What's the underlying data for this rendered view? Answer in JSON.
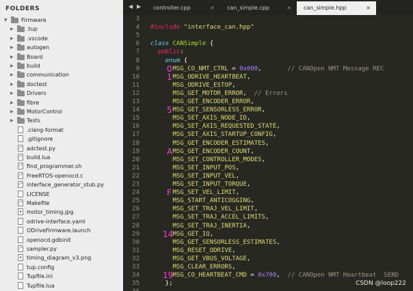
{
  "sidebar": {
    "title": "FOLDERS",
    "root": "Firmware",
    "folders": [
      ".tup",
      ".vscode",
      "autogen",
      "Board",
      "build",
      "communication",
      "doctest",
      "Drivers",
      "fibre",
      "MotorControl",
      "Tests"
    ],
    "files": [
      {
        "name": ".clang-format",
        "icon": "file-icon"
      },
      {
        "name": ".gitignore",
        "icon": "file-icon"
      },
      {
        "name": "adctest.py",
        "icon": "code-file-icon"
      },
      {
        "name": "build.lua",
        "icon": "code-file-icon"
      },
      {
        "name": "find_programmer.sh",
        "icon": "code-file-icon"
      },
      {
        "name": "FreeRTOS-openocd.c",
        "icon": "code-file-icon"
      },
      {
        "name": "interface_generator_stub.py",
        "icon": "code-file-icon"
      },
      {
        "name": "LICENSE",
        "icon": "file-icon"
      },
      {
        "name": "Makefile",
        "icon": "code-file-icon"
      },
      {
        "name": "motor_timing.jpg",
        "icon": "image-file-icon"
      },
      {
        "name": "odrive-interface.yaml",
        "icon": "file-icon"
      },
      {
        "name": "ODriveFirmware.launch",
        "icon": "file-icon"
      },
      {
        "name": "openocd.gdbinit",
        "icon": "file-icon"
      },
      {
        "name": "sampler.py",
        "icon": "code-file-icon"
      },
      {
        "name": "timing_diagram_v3.png",
        "icon": "image-file-icon"
      },
      {
        "name": "tup.config",
        "icon": "file-icon"
      },
      {
        "name": "Tupfile.ini",
        "icon": "file-icon"
      },
      {
        "name": "Tupfile.lua",
        "icon": "file-icon"
      }
    ]
  },
  "tabs": [
    {
      "label": "controller.cpp",
      "active": false,
      "close": "×"
    },
    {
      "label": "can_simple.cpp",
      "active": false,
      "close": "×"
    },
    {
      "label": "can_simple.hpp",
      "active": true,
      "close": "×"
    }
  ],
  "tab_nav": {
    "left": "◀",
    "right": "▶"
  },
  "editor": {
    "lines": [
      {
        "n": "3",
        "segs": []
      },
      {
        "n": "4",
        "segs": [
          [
            "kw-pre",
            "#include "
          ],
          [
            "str",
            "\"interface_can.hpp\""
          ]
        ]
      },
      {
        "n": "5",
        "segs": []
      },
      {
        "n": "6",
        "segs": [
          [
            "kw-class",
            "class"
          ],
          [
            "pun",
            " "
          ],
          [
            "cls",
            "CANSimple"
          ],
          [
            "pun",
            " {"
          ]
        ]
      },
      {
        "n": "7",
        "segs": [
          [
            "pun",
            "  "
          ],
          [
            "kw",
            "public"
          ],
          [
            "pun",
            ":"
          ]
        ]
      },
      {
        "n": "8",
        "segs": [
          [
            "pun",
            "    "
          ],
          [
            "kw-enum",
            "enum"
          ],
          [
            "pun",
            " {"
          ]
        ]
      },
      {
        "n": "9",
        "segs": [
          [
            "pun",
            "      "
          ],
          [
            "enumv",
            "MSG_CO_NMT_CTRL"
          ],
          [
            "pun",
            " = "
          ],
          [
            "num",
            "0x000"
          ],
          [
            "pun",
            ",       "
          ],
          [
            "cmt",
            "// CANOpen NMT Message REC"
          ]
        ]
      },
      {
        "n": "10",
        "segs": [
          [
            "pun",
            "      "
          ],
          [
            "enumv",
            "MSG_ODRIVE_HEARTBEAT"
          ],
          [
            "pun",
            ","
          ]
        ]
      },
      {
        "n": "11",
        "segs": [
          [
            "pun",
            "      "
          ],
          [
            "enumv",
            "MSG_ODRIVE_ESTOP"
          ],
          [
            "pun",
            ","
          ]
        ]
      },
      {
        "n": "12",
        "segs": [
          [
            "pun",
            "      "
          ],
          [
            "enumv",
            "MSG_GET_MOTOR_ERROR"
          ],
          [
            "pun",
            ",  "
          ],
          [
            "cmt",
            "// Errors"
          ]
        ]
      },
      {
        "n": "13",
        "segs": [
          [
            "pun",
            "      "
          ],
          [
            "enumv",
            "MSG_GET_ENCODER_ERROR"
          ],
          [
            "pun",
            ","
          ]
        ]
      },
      {
        "n": "14",
        "segs": [
          [
            "pun",
            "      "
          ],
          [
            "enumv",
            "MSG_GET_SENSORLESS_ERROR"
          ],
          [
            "pun",
            ","
          ]
        ]
      },
      {
        "n": "15",
        "segs": [
          [
            "pun",
            "      "
          ],
          [
            "enumv",
            "MSG_SET_AXIS_NODE_ID"
          ],
          [
            "pun",
            ","
          ]
        ]
      },
      {
        "n": "16",
        "segs": [
          [
            "pun",
            "      "
          ],
          [
            "enumv",
            "MSG_SET_AXIS_REQUESTED_STATE"
          ],
          [
            "pun",
            ","
          ]
        ]
      },
      {
        "n": "17",
        "segs": [
          [
            "pun",
            "      "
          ],
          [
            "enumv",
            "MSG_SET_AXIS_STARTUP_CONFIG"
          ],
          [
            "pun",
            ","
          ]
        ]
      },
      {
        "n": "18",
        "segs": [
          [
            "pun",
            "      "
          ],
          [
            "enumv",
            "MSG_GET_ENCODER_ESTIMATES"
          ],
          [
            "pun",
            ","
          ]
        ]
      },
      {
        "n": "19",
        "segs": [
          [
            "pun",
            "      "
          ],
          [
            "enumv",
            "MSG_GET_ENCODER_COUNT"
          ],
          [
            "pun",
            ","
          ]
        ]
      },
      {
        "n": "20",
        "segs": [
          [
            "pun",
            "      "
          ],
          [
            "enumv",
            "MSG_SET_CONTROLLER_MODES"
          ],
          [
            "pun",
            ","
          ]
        ]
      },
      {
        "n": "21",
        "segs": [
          [
            "pun",
            "      "
          ],
          [
            "enumv",
            "MSG_SET_INPUT_POS"
          ],
          [
            "pun",
            ","
          ]
        ]
      },
      {
        "n": "22",
        "segs": [
          [
            "pun",
            "      "
          ],
          [
            "enumv",
            "MSG_SET_INPUT_VEL"
          ],
          [
            "pun",
            ","
          ]
        ]
      },
      {
        "n": "23",
        "segs": [
          [
            "pun",
            "      "
          ],
          [
            "enumv",
            "MSG_SET_INPUT_TORQUE"
          ],
          [
            "pun",
            ","
          ]
        ]
      },
      {
        "n": "24",
        "segs": [
          [
            "pun",
            "      "
          ],
          [
            "enumv",
            "MSG_SET_VEL_LIMIT"
          ],
          [
            "pun",
            ","
          ]
        ]
      },
      {
        "n": "25",
        "segs": [
          [
            "pun",
            "      "
          ],
          [
            "enumv",
            "MSG_START_ANTICOGGING"
          ],
          [
            "pun",
            ","
          ]
        ]
      },
      {
        "n": "26",
        "segs": [
          [
            "pun",
            "      "
          ],
          [
            "enumv",
            "MSG_SET_TRAJ_VEL_LIMIT"
          ],
          [
            "pun",
            ","
          ]
        ]
      },
      {
        "n": "27",
        "segs": [
          [
            "pun",
            "      "
          ],
          [
            "enumv",
            "MSG_SET_TRAJ_ACCEL_LIMITS"
          ],
          [
            "pun",
            ","
          ]
        ]
      },
      {
        "n": "28",
        "segs": [
          [
            "pun",
            "      "
          ],
          [
            "enumv",
            "MSG_SET_TRAJ_INERTIA"
          ],
          [
            "pun",
            ","
          ]
        ]
      },
      {
        "n": "29",
        "segs": [
          [
            "pun",
            "      "
          ],
          [
            "enumv",
            "MSG_GET_IQ"
          ],
          [
            "pun",
            ","
          ]
        ]
      },
      {
        "n": "30",
        "segs": [
          [
            "pun",
            "      "
          ],
          [
            "enumv",
            "MSG_GET_SENSORLESS_ESTIMATES"
          ],
          [
            "pun",
            ","
          ]
        ]
      },
      {
        "n": "31",
        "segs": [
          [
            "pun",
            "      "
          ],
          [
            "enumv",
            "MSG_RESET_ODRIVE"
          ],
          [
            "pun",
            ","
          ]
        ]
      },
      {
        "n": "32",
        "segs": [
          [
            "pun",
            "      "
          ],
          [
            "enumv",
            "MSG_GET_VBUS_VOLTAGE"
          ],
          [
            "pun",
            ","
          ]
        ]
      },
      {
        "n": "33",
        "segs": [
          [
            "pun",
            "      "
          ],
          [
            "enumv",
            "MSG_CLEAR_ERRORS"
          ],
          [
            "pun",
            ","
          ]
        ]
      },
      {
        "n": "34",
        "segs": [
          [
            "pun",
            "      "
          ],
          [
            "enumv",
            "MSG_CO_HEARTBEAT_CMD"
          ],
          [
            "pun",
            " = "
          ],
          [
            "num",
            "0x700"
          ],
          [
            "pun",
            ",  "
          ],
          [
            "cmt",
            "// CANOpen NMT Heartbeat  SEND"
          ]
        ]
      },
      {
        "n": "35",
        "segs": [
          [
            "pun",
            "    };"
          ]
        ]
      },
      {
        "n": "36",
        "segs": []
      }
    ],
    "annotations": [
      {
        "line": 6,
        "text": "0"
      },
      {
        "line": 7,
        "text": "1"
      },
      {
        "line": 11,
        "text": "5"
      },
      {
        "line": 16,
        "text": "A"
      },
      {
        "line": 21,
        "text": "F"
      },
      {
        "line": 26,
        "text": "14"
      },
      {
        "line": 31,
        "text": "19"
      }
    ],
    "annotation_color": "#ff3ddc"
  },
  "watermark": "CSDN @loop222"
}
